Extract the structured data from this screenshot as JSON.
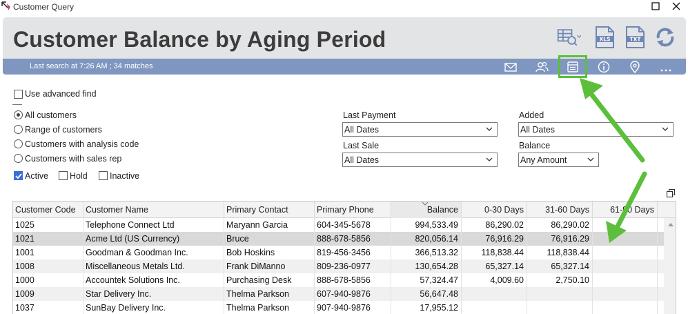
{
  "window": {
    "title": "Customer Query"
  },
  "header": {
    "title": "Customer Balance by Aging Period",
    "search_info": "Last search at 7:26 AM ; 34 matches"
  },
  "colors": {
    "highlight": "#5cbf3c",
    "subbar": "#7f97c0",
    "header_bg": "#e3e4e6",
    "icon_blue": "#6f87b5"
  },
  "toolbar_icons": [
    "grid-search-icon",
    "xls-export-icon",
    "txt-export-icon",
    "refresh-icon"
  ],
  "subbar_icons": [
    "email-icon",
    "contacts-icon",
    "notes-icon",
    "info-icon",
    "location-icon",
    "more-icon"
  ],
  "filters": {
    "use_advanced_find": "Use advanced find",
    "scope_options": [
      "All customers",
      "Range of customers",
      "Customers with analysis code",
      "Customers with sales rep"
    ],
    "scope_selected": "All customers",
    "status": {
      "active": "Active",
      "hold": "Hold",
      "inactive": "Inactive"
    },
    "last_payment_label": "Last Payment",
    "last_payment_value": "All Dates",
    "last_sale_label": "Last Sale",
    "last_sale_value": "All Dates",
    "added_label": "Added",
    "added_value": "All Dates",
    "balance_label": "Balance",
    "balance_value": "Any Amount"
  },
  "table": {
    "columns": [
      "Customer Code",
      "Customer Name",
      "Primary Contact",
      "Primary Phone",
      "Balance",
      "0-30 Days",
      "31-60 Days",
      "61-90 Days"
    ],
    "rows": [
      [
        "1025",
        "Telephone Connect Ltd",
        "Maryann Garcia",
        "604-345-5678",
        "994,533.49",
        "86,290.02",
        "86,290.02",
        ""
      ],
      [
        "1021",
        "Acme Ltd (US Currency)",
        "Bruce",
        "888-678-5856",
        "820,056.14",
        "76,916.29",
        "76,916.29",
        ""
      ],
      [
        "1001",
        "Goodman & Goodman Inc.",
        "Bob Hoskins",
        "819-456-3456",
        "366,513.32",
        "118,838.44",
        "118,838.44",
        ""
      ],
      [
        "1008",
        "Miscellaneous Metals Ltd.",
        "Frank DiManno",
        "809-236-0977",
        "130,654.28",
        "65,327.14",
        "65,327.14",
        ""
      ],
      [
        "1000",
        "Accountek Solutions Inc.",
        "Purchasing Desk",
        "888-678-5856",
        "57,324.47",
        "4,009.60",
        "2,750.10",
        ""
      ],
      [
        "1009",
        "Star Delivery Inc.",
        "Thelma Parkson",
        "607-940-9876",
        "56,647.48",
        "",
        "",
        ""
      ],
      [
        "1037",
        "SunBay Delivery Inc.",
        "Thelma Parkson",
        "907-940-9876",
        "17,955.12",
        "",
        "",
        ""
      ]
    ],
    "selected_row": 1
  }
}
